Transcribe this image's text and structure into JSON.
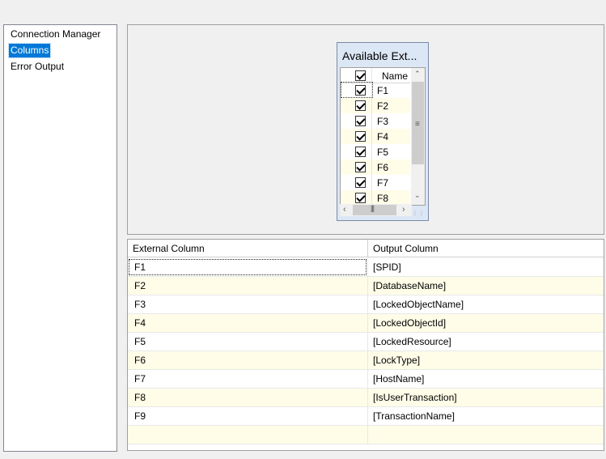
{
  "nav": {
    "items": [
      {
        "label": "Connection Manager",
        "selected": false
      },
      {
        "label": "Columns",
        "selected": true
      },
      {
        "label": "Error Output",
        "selected": false
      }
    ]
  },
  "available": {
    "title": "Available Ext...",
    "header_label": "Name",
    "columns": [
      {
        "name": "F1",
        "checked": true
      },
      {
        "name": "F2",
        "checked": true
      },
      {
        "name": "F3",
        "checked": true
      },
      {
        "name": "F4",
        "checked": true
      },
      {
        "name": "F5",
        "checked": true
      },
      {
        "name": "F6",
        "checked": true
      },
      {
        "name": "F7",
        "checked": true
      },
      {
        "name": "F8",
        "checked": true
      }
    ]
  },
  "mapping": {
    "headers": {
      "external": "External Column",
      "output": "Output Column"
    },
    "rows": [
      {
        "external": "F1",
        "output": "[SPID]"
      },
      {
        "external": "F2",
        "output": "[DatabaseName]"
      },
      {
        "external": "F3",
        "output": "[LockedObjectName]"
      },
      {
        "external": "F4",
        "output": "[LockedObjectId]"
      },
      {
        "external": "F5",
        "output": "[LockedResource]"
      },
      {
        "external": "F6",
        "output": "[LockType]"
      },
      {
        "external": "F7",
        "output": "[HostName]"
      },
      {
        "external": "F8",
        "output": "[IsUserTransaction]"
      },
      {
        "external": "F9",
        "output": "[TransactionName]"
      }
    ]
  }
}
